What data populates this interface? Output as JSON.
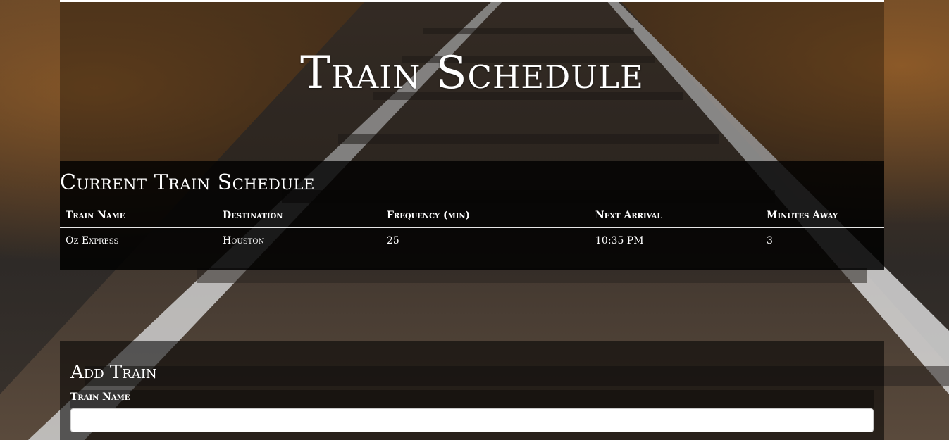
{
  "header": {
    "title": "Train Schedule"
  },
  "schedule": {
    "title": "Current Train Schedule",
    "columns": [
      "Train Name",
      "Destination",
      "Frequency (min)",
      "Next Arrival",
      "Minutes Away"
    ],
    "rows": [
      {
        "train_name": "Oz Express",
        "destination": "Houston",
        "frequency": "25",
        "next_arrival": "10:35 PM",
        "minutes_away": "3"
      }
    ]
  },
  "add_train": {
    "title": "Add Train",
    "train_name_label": "Train Name",
    "train_name_value": ""
  },
  "colors": {
    "text": "#ffffff",
    "panel": "#000000",
    "input_bg": "#ffffff"
  }
}
